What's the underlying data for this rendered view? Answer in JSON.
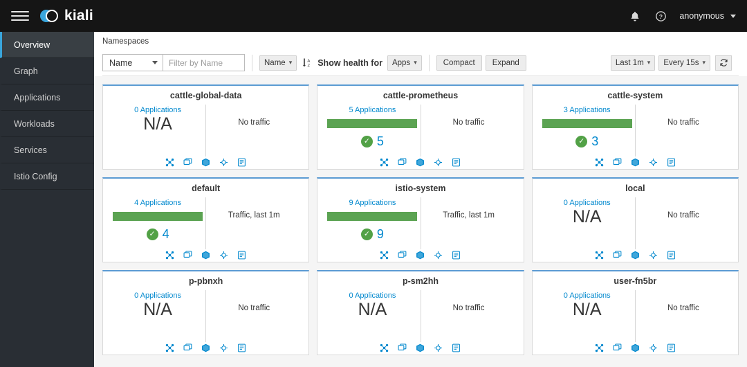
{
  "masthead": {
    "menu_icon": "hamburger-icon",
    "brand": "kiali",
    "notification_icon": "bell-icon",
    "help_icon": "help-icon",
    "user": "anonymous"
  },
  "sidebar": {
    "items": [
      {
        "label": "Overview",
        "active": true
      },
      {
        "label": "Graph",
        "active": false
      },
      {
        "label": "Applications",
        "active": false
      },
      {
        "label": "Workloads",
        "active": false
      },
      {
        "label": "Services",
        "active": false
      },
      {
        "label": "Istio Config",
        "active": false
      }
    ]
  },
  "page": {
    "breadcrumb": "Namespaces"
  },
  "toolbar": {
    "filter_category": "Name",
    "filter_placeholder": "Filter by Name",
    "sort_field": "Name",
    "sort_icon": "sort-amount-asc-icon",
    "health_label": "Show health for",
    "health_scope": "Apps",
    "compact_label": "Compact",
    "expand_label": "Expand",
    "duration": "Last 1m",
    "refresh_interval": "Every 15s",
    "refresh_icon": "refresh-icon"
  },
  "card_icons": [
    {
      "name": "graph-icon"
    },
    {
      "name": "applications-icon"
    },
    {
      "name": "workloads-icon"
    },
    {
      "name": "services-icon"
    },
    {
      "name": "istio-config-icon"
    }
  ],
  "colors": {
    "accent_blue": "#0088ce",
    "card_top_border": "#5b9bd3",
    "health_green": "#5ba352",
    "masthead_bg": "#151515",
    "sidebar_bg": "#292e34"
  },
  "namespaces": [
    {
      "name": "cattle-global-data",
      "apps_label": "0 Applications",
      "has_health": false,
      "health_value": "N/A",
      "health_count": "",
      "traffic": "No traffic"
    },
    {
      "name": "cattle-prometheus",
      "apps_label": "5 Applications",
      "has_health": true,
      "health_value": "",
      "health_count": "5",
      "traffic": "No traffic"
    },
    {
      "name": "cattle-system",
      "apps_label": "3 Applications",
      "has_health": true,
      "health_value": "",
      "health_count": "3",
      "traffic": "No traffic"
    },
    {
      "name": "default",
      "apps_label": "4 Applications",
      "has_health": true,
      "health_value": "",
      "health_count": "4",
      "traffic": "Traffic, last 1m"
    },
    {
      "name": "istio-system",
      "apps_label": "9 Applications",
      "has_health": true,
      "health_value": "",
      "health_count": "9",
      "traffic": "Traffic, last 1m"
    },
    {
      "name": "local",
      "apps_label": "0 Applications",
      "has_health": false,
      "health_value": "N/A",
      "health_count": "",
      "traffic": "No traffic"
    },
    {
      "name": "p-pbnxh",
      "apps_label": "0 Applications",
      "has_health": false,
      "health_value": "N/A",
      "health_count": "",
      "traffic": "No traffic"
    },
    {
      "name": "p-sm2hh",
      "apps_label": "0 Applications",
      "has_health": false,
      "health_value": "N/A",
      "health_count": "",
      "traffic": "No traffic"
    },
    {
      "name": "user-fn5br",
      "apps_label": "0 Applications",
      "has_health": false,
      "health_value": "N/A",
      "health_count": "",
      "traffic": "No traffic"
    }
  ]
}
